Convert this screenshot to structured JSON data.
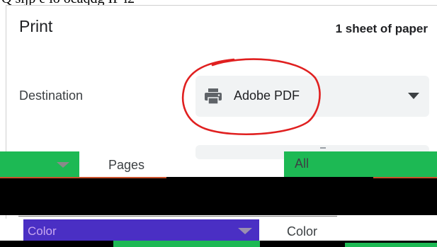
{
  "top_strip_text": "Q  sljp e  io ocaqdg IP  i2",
  "print_dialog": {
    "title": "Print",
    "sheet_count": "1 sheet of paper",
    "destination": {
      "label": "Destination",
      "value": "Adobe PDF",
      "icon": "printer-icon"
    },
    "pages": {
      "label": "Pages",
      "value": "All"
    },
    "color": {
      "label": "Color",
      "value": "Color"
    }
  },
  "annotation": {
    "type": "hand-drawn circle",
    "color": "#e02020"
  },
  "colors": {
    "select_bg": "#f1f3f4",
    "glitch_green": "#1db954",
    "glitch_purple": "#4a2fc4",
    "glitch_orange": "#c8502a"
  }
}
